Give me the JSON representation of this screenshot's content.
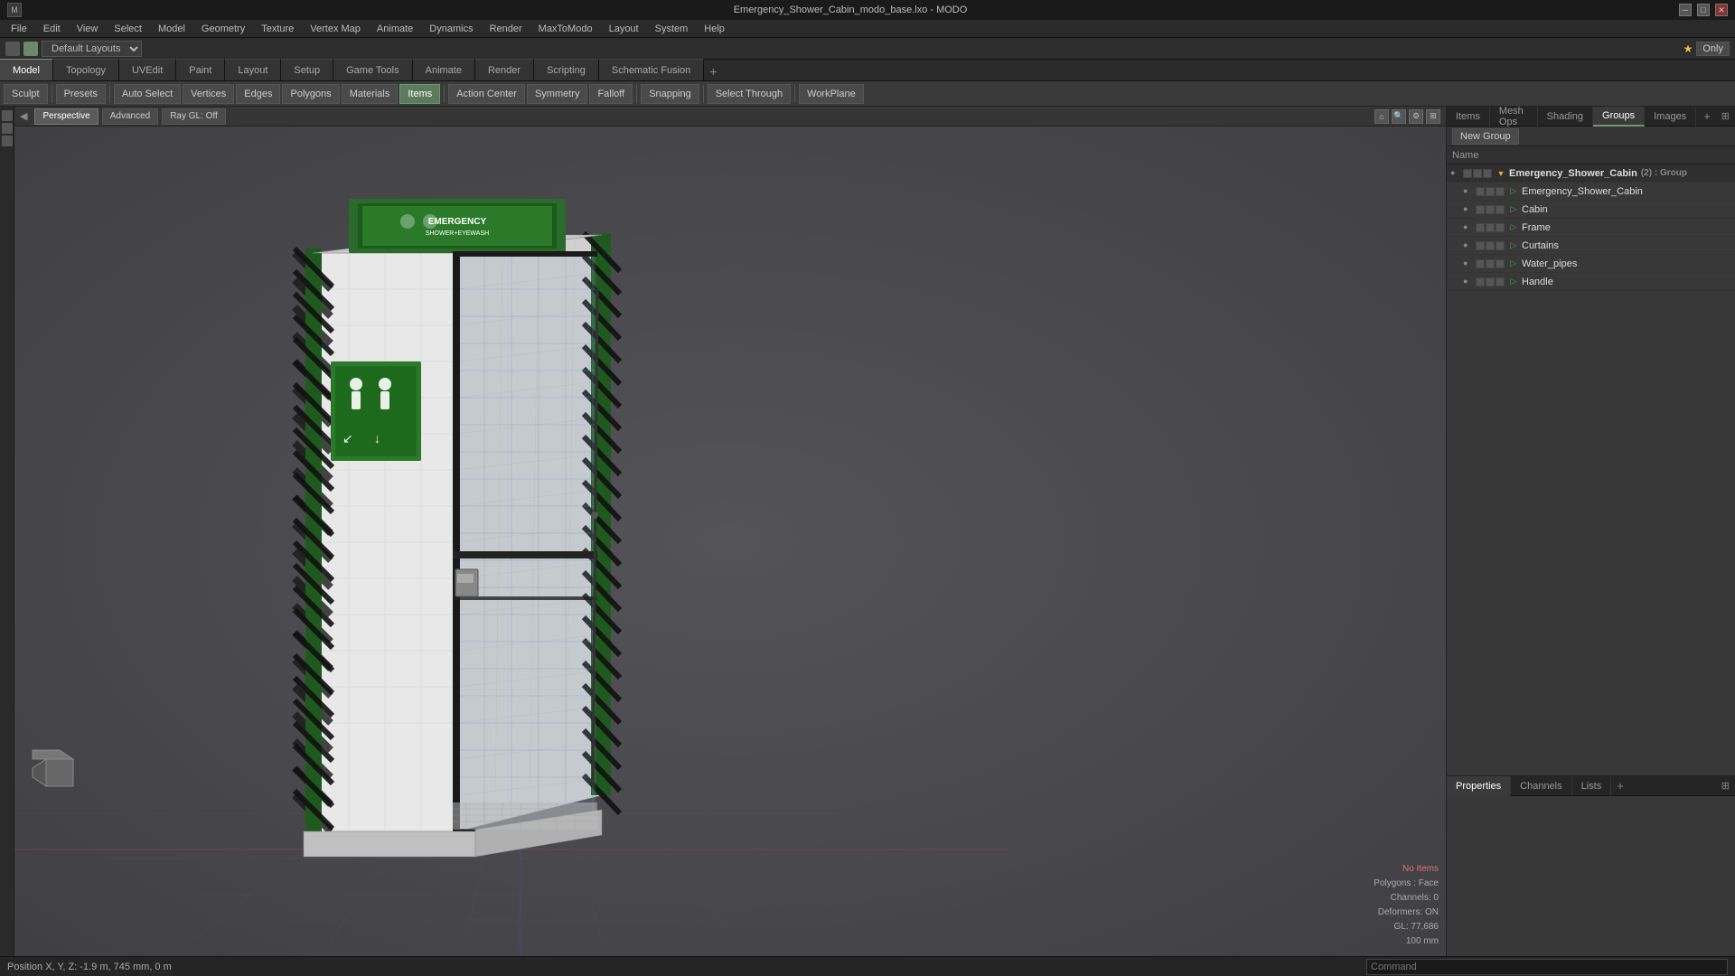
{
  "titlebar": {
    "title": "Emergency_Shower_Cabin_modo_base.lxo - MODO",
    "min_btn": "─",
    "max_btn": "□",
    "close_btn": "✕"
  },
  "menubar": {
    "items": [
      "File",
      "Edit",
      "View",
      "Select",
      "Model",
      "Geometry",
      "Texture",
      "Vertex Map",
      "Animate",
      "Dynamics",
      "Render",
      "MaxToModo",
      "Layout",
      "System",
      "Help"
    ]
  },
  "layoutbar": {
    "dropdown_label": "Default Layouts",
    "only_btn": "Only"
  },
  "mode_tabs": {
    "tabs": [
      "Model",
      "Topology",
      "UVEdit",
      "Paint",
      "Layout",
      "Setup",
      "Game Tools",
      "Animate",
      "Render",
      "Scripting",
      "Schematic Fusion"
    ],
    "active": "Model"
  },
  "toolbar": {
    "sculpt": "Sculpt",
    "presets": "Presets",
    "auto_select": "Auto Select",
    "vertices": "Vertices",
    "edges": "Edges",
    "polygons": "Polygons",
    "materials": "Materials",
    "items": "Items",
    "action_center": "Action Center",
    "symmetry": "Symmetry",
    "falloff": "Falloff",
    "snapping": "Snapping",
    "select_through": "Select Through",
    "workplane": "WorkPlane"
  },
  "viewport": {
    "view_label": "Perspective",
    "advanced_btn": "Advanced",
    "raygl_btn": "Ray GL: Off"
  },
  "right_panel": {
    "tabs": [
      "Items",
      "Mesh Ops",
      "Shading",
      "Groups",
      "Images"
    ],
    "active": "Groups",
    "new_group_btn": "New Group",
    "name_col": "Name",
    "items": [
      {
        "id": "group_root",
        "label": "Emergency_Shower_Cabin",
        "suffix": "(2) : Group",
        "type": "group",
        "indent": 0,
        "selected": true
      },
      {
        "id": "shower_cabin",
        "label": "Emergency_Shower_Cabin",
        "type": "mesh",
        "indent": 1
      },
      {
        "id": "cabin",
        "label": "Cabin",
        "type": "mesh",
        "indent": 1
      },
      {
        "id": "frame",
        "label": "Frame",
        "type": "mesh",
        "indent": 1
      },
      {
        "id": "curtains",
        "label": "Curtains",
        "type": "mesh",
        "indent": 1
      },
      {
        "id": "water_pipes",
        "label": "Water_pipes",
        "type": "mesh",
        "indent": 1
      },
      {
        "id": "handle",
        "label": "Handle",
        "type": "mesh",
        "indent": 1
      }
    ]
  },
  "properties_panel": {
    "tabs": [
      "Properties",
      "Channels",
      "Lists"
    ],
    "active": "Properties"
  },
  "info": {
    "no_items": "No Items",
    "polygons": "Polygons : Face",
    "channels": "Channels: 0",
    "deformers": "Deformers: ON",
    "gl": "GL: 77,686",
    "size": "100 mm"
  },
  "statusbar": {
    "position": "Position X, Y, Z:  -1.9 m, 745 mm, 0 m",
    "command_placeholder": "Command"
  },
  "colors": {
    "accent_green": "#5c8a5c",
    "active_tab_bg": "#454545",
    "selected_item": "#3a5a3a",
    "dot_green": "#4a9a4a",
    "dot_grey": "#888888"
  }
}
